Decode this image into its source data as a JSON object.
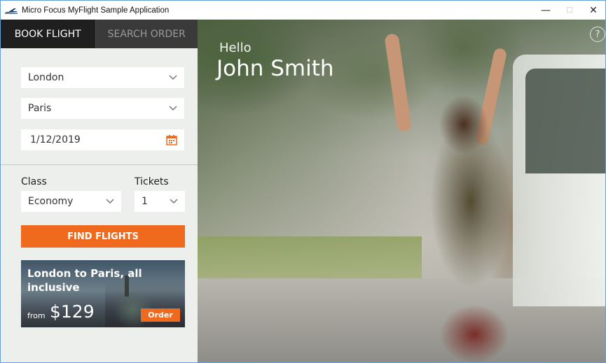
{
  "window": {
    "title": "Micro Focus MyFlight Sample Application",
    "controls": {
      "minimize": "—",
      "maximize": "☐",
      "close": "✕"
    }
  },
  "tabs": [
    {
      "label": "BOOK FLIGHT",
      "active": true
    },
    {
      "label": "SEARCH ORDER",
      "active": false
    }
  ],
  "form": {
    "from": "London",
    "to": "Paris",
    "date": "1/12/2019",
    "class_label": "Class",
    "tickets_label": "Tickets",
    "class_value": "Economy",
    "tickets_value": "1",
    "find_button": "FIND FLIGHTS"
  },
  "promo": {
    "title": "London to Paris, all inclusive",
    "from_text": "from",
    "price": "$129",
    "order_button": "Order"
  },
  "greeting": {
    "hello": "Hello",
    "name": "John Smith"
  },
  "icons": {
    "app": "airplane-icon",
    "calendar": "calendar-icon",
    "help": "help-icon",
    "dropdown": "chevron-down-icon"
  },
  "colors": {
    "accent": "#f06a1d",
    "tab_bar": "#2b2b2b"
  }
}
